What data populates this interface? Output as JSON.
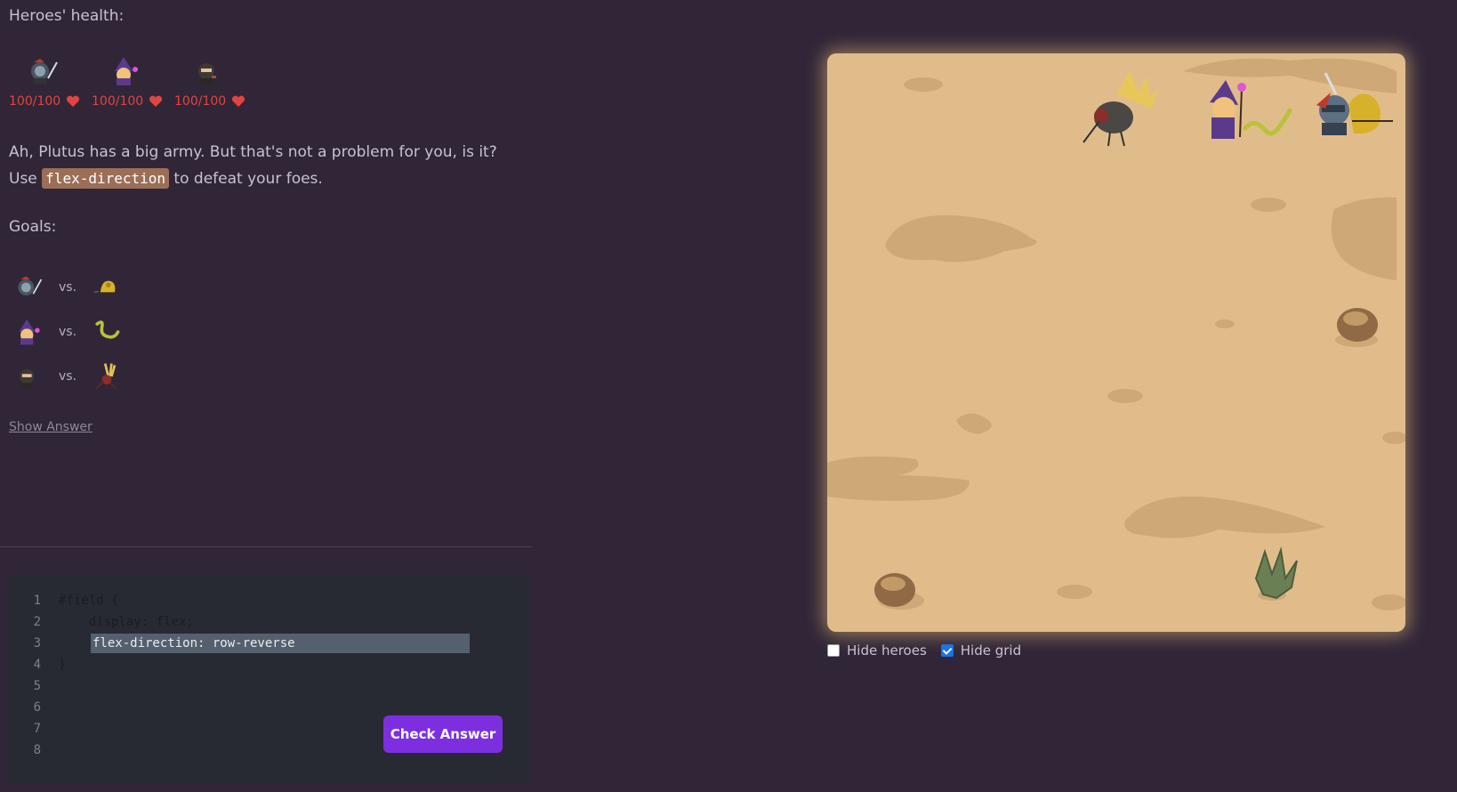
{
  "health_title": "Heroes' health:",
  "heroes": [
    {
      "name_icon": "knight-icon",
      "hp": "100/100"
    },
    {
      "name_icon": "wizard-icon",
      "hp": "100/100"
    },
    {
      "name_icon": "rogue-icon",
      "hp": "100/100"
    }
  ],
  "story": {
    "text_before": "Ah, Plutus has a big army. But that's not a problem for you, is it? Use ",
    "code": "flex-direction",
    "text_after": " to defeat your foes."
  },
  "goals_title": "Goals:",
  "goals": [
    {
      "hero_icon": "knight-icon",
      "vs": "vs.",
      "enemy_icon": "golden-beast-icon"
    },
    {
      "hero_icon": "wizard-icon",
      "vs": "vs.",
      "enemy_icon": "snake-icon"
    },
    {
      "hero_icon": "rogue-icon",
      "vs": "vs.",
      "enemy_icon": "spider-icon"
    }
  ],
  "show_answer": "Show Answer",
  "editor": {
    "lines": [
      {
        "num": "1",
        "code": "#field {"
      },
      {
        "num": "2",
        "code": "    display: flex;"
      },
      {
        "num": "3",
        "code": "flex-direction: row-reverse"
      },
      {
        "num": "4",
        "code": "}"
      },
      {
        "num": "5",
        "code": ""
      },
      {
        "num": "6",
        "code": ""
      },
      {
        "num": "7",
        "code": ""
      },
      {
        "num": "8",
        "code": ""
      }
    ]
  },
  "check_button": "Check Answer",
  "options": {
    "hide_heroes": "Hide heroes",
    "hide_heroes_checked": false,
    "hide_grid": "Hide grid",
    "hide_grid_checked": true
  },
  "colors": {
    "background": "#302638",
    "field_sand": "#e1bc8b",
    "hp_red": "#e3443f",
    "button_purple": "#7d2fe0",
    "code_tag": "#9b6e57"
  }
}
